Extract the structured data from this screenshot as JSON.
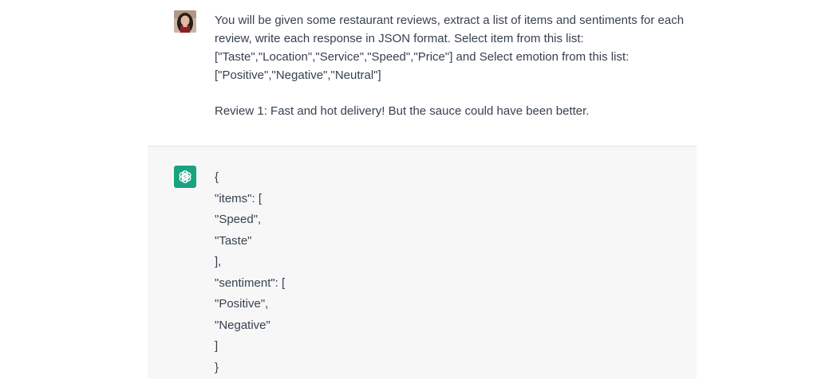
{
  "user_message": {
    "line1": "You will be given some restaurant reviews, extract a list of items and sentiments for each",
    "line2": "review, write each response in JSON format. Select item from this list:",
    "line3": "[\"Taste\",\"Location\",\"Service\",\"Speed\",\"Price\"] and Select emotion from this list:",
    "line4": "[\"Positive\",\"Negative\",\"Neutral\"]",
    "review": "Review 1: Fast and hot delivery! But the sauce could have been better."
  },
  "assistant_message": {
    "lines": [
      "{",
      "\"items\": [",
      "\"Speed\",",
      "\"Taste\"",
      "],",
      "\"sentiment\": [",
      "\"Positive\",",
      "\"Negative\"",
      "]",
      "}"
    ]
  },
  "icons": {
    "user_avatar": "user-photo-avatar",
    "assistant_avatar": "openai-logo-icon"
  },
  "colors": {
    "assistant_bg": "#f7f7f8",
    "assistant_logo_bg": "#19a37f",
    "text": "#374151"
  }
}
